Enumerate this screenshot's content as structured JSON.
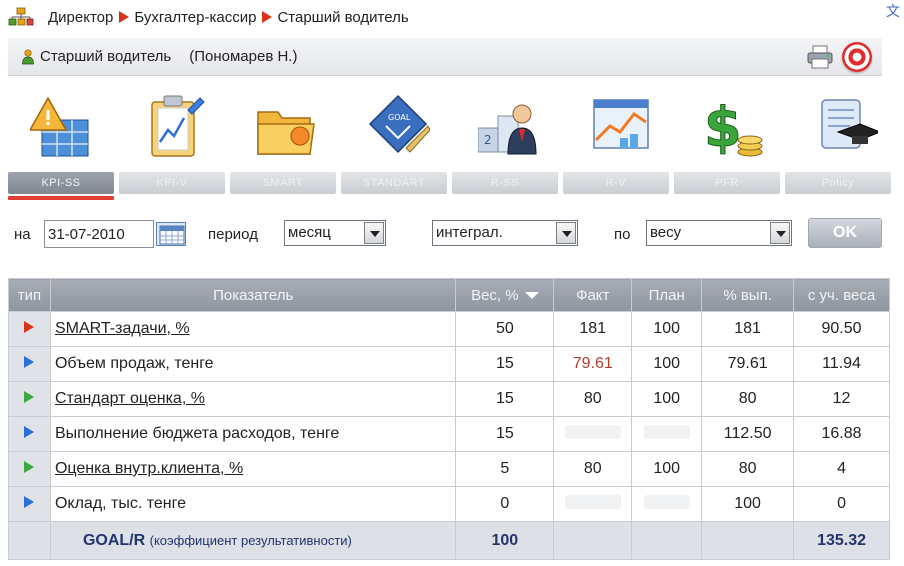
{
  "breadcrumb": [
    "Директор",
    "Бухгалтер-кассир",
    "Старший водитель"
  ],
  "header": {
    "title": "Старший водитель",
    "person": "(Пономарев Н.)"
  },
  "toolbar_icons": [
    {
      "icon": "kpi-grid-icon",
      "tab": "KPI-SS"
    },
    {
      "icon": "kpi-chart-icon",
      "tab": "KPI-V"
    },
    {
      "icon": "smart-folder-icon",
      "tab": "SMART"
    },
    {
      "icon": "standard-goal-icon",
      "tab": "STANDART"
    },
    {
      "icon": "r-ss-podium-icon",
      "tab": "R-SS"
    },
    {
      "icon": "r-v-chart-icon",
      "tab": "R-V"
    },
    {
      "icon": "pfr-money-icon",
      "tab": "PFR"
    },
    {
      "icon": "policy-scroll-icon",
      "tab": "Policy"
    }
  ],
  "filters": {
    "date_label": "на",
    "date_value": "31-07-2010",
    "period_label": "период",
    "period_value": "месяц",
    "mode_value": "интеграл.",
    "by_label": "по",
    "by_value": "весу",
    "ok_label": "OK"
  },
  "table": {
    "headers": [
      "тип",
      "Показатель",
      "Вес, %",
      "Факт",
      "План",
      "% вып.",
      "с уч. веса"
    ],
    "rows": [
      {
        "flag": "#d8341c",
        "name": "SMART-задачи, %",
        "link": true,
        "weight": "50",
        "fact": "181",
        "plan": "100",
        "pct": "181",
        "weighted": "90.50"
      },
      {
        "flag": "#2b6fd6",
        "name": "Объем продаж, тенге",
        "link": false,
        "weight": "15",
        "fact": "79.61",
        "plan": "100",
        "pct": "79.61",
        "weighted": "11.94"
      },
      {
        "flag": "#3aa83a",
        "name": "Стандарт оценка, %",
        "link": true,
        "weight": "15",
        "fact": "80",
        "plan": "100",
        "pct": "80",
        "weighted": "12"
      },
      {
        "flag": "#2b6fd6",
        "name": "Выполнение бюджета расходов, тенге",
        "link": false,
        "weight": "15",
        "fact": "",
        "plan": "",
        "pct": "112.50",
        "weighted": "16.88"
      },
      {
        "flag": "#3aa83a",
        "name": "Оценка внутр.клиента, %",
        "link": true,
        "weight": "5",
        "fact": "80",
        "plan": "100",
        "pct": "80",
        "weighted": "4"
      },
      {
        "flag": "#2b6fd6",
        "name": "Оклад, тыс. тенге",
        "link": false,
        "weight": "0",
        "fact": "",
        "plan": "",
        "pct": "100",
        "weighted": "0"
      }
    ],
    "total": {
      "label": "GOAL/R",
      "sublabel": "(коэффициент результативности)",
      "weight": "100",
      "weighted": "135.32"
    }
  },
  "colors": {
    "accent_red": "#d8341c",
    "header_gray": "#9aa0a9",
    "fact_red": "#b23c2c"
  }
}
